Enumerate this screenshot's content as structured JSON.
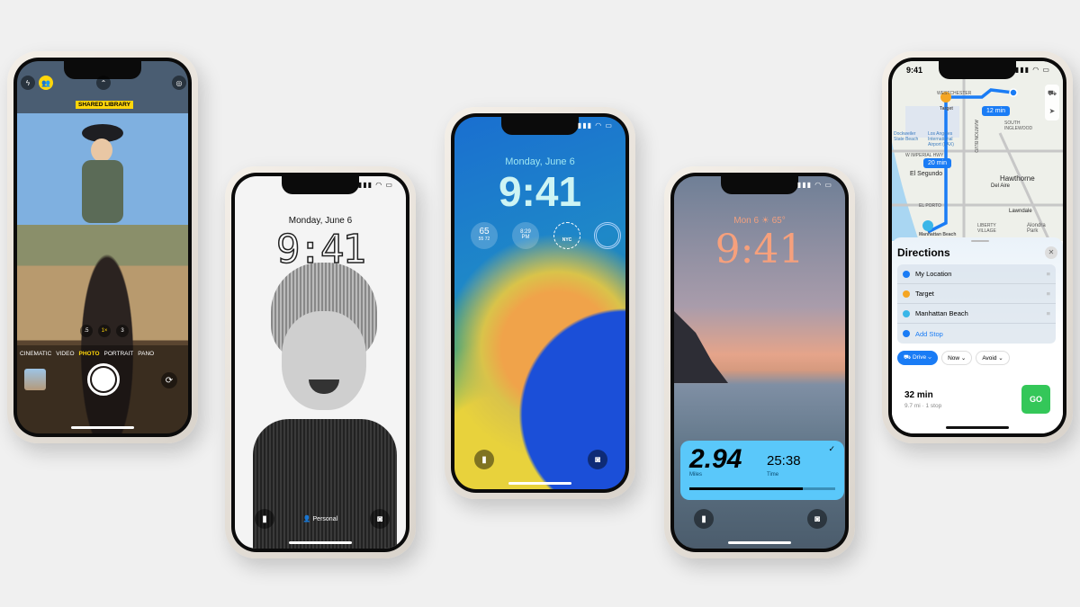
{
  "camera": {
    "shared_library": "SHARED LIBRARY",
    "zoom": [
      ".5",
      "1×",
      "3"
    ],
    "modes": [
      "CINEMATIC",
      "VIDEO",
      "PHOTO",
      "PORTRAIT",
      "PANO"
    ],
    "active_mode": "PHOTO",
    "accent": "#ffd60a"
  },
  "lock_bw": {
    "date": "Monday, June 6",
    "time": "9:41",
    "focus": "Personal"
  },
  "lock_blue": {
    "date": "Monday, June 6",
    "time": "9:41",
    "widgets": {
      "temp": "65",
      "range_lo": "55",
      "range_hi": "72",
      "sunset": "8:29",
      "sunset_ampm": "PM",
      "clock_city": "NYC"
    }
  },
  "lock_sunset": {
    "date": "Mon 6",
    "weather": "☀ 65°",
    "time": "9:41",
    "workout": {
      "miles": "2.94",
      "miles_label": "Miles",
      "time": "25:38",
      "time_label": "Time",
      "progress": 0.78
    },
    "accent": "#5ac8fa"
  },
  "maps": {
    "status_time": "9:41",
    "labels": {
      "westchester": "WESTCHESTER",
      "target": "Target",
      "south_inglewood": "SOUTH INGLEWOOD",
      "dockweiler": "Dockweiler State Beach",
      "lax": "Los Angeles International Airport (LAX)",
      "imperial": "W IMPERIAL HWY",
      "el_segundo": "El Segundo",
      "hawthorne": "Hawthorne",
      "del_aire": "Del Aire",
      "el_porto": "EL PORTO",
      "lawndale": "Lawndale",
      "liberty": "LIBERTY VILLAGE",
      "alondra": "Alondra Park",
      "manhattan": "Manhattan Beach",
      "aviation": "AVIATION BLVD"
    },
    "eta1": "12 min",
    "eta2": "20 min",
    "title": "Directions",
    "stops": [
      "My Location",
      "Target",
      "Manhattan Beach"
    ],
    "add_stop": "Add Stop",
    "chips": {
      "drive": "Drive",
      "now": "Now",
      "avoid": "Avoid"
    },
    "route": {
      "duration": "32 min",
      "detail": "9.7 mi · 1 stop",
      "go": "GO"
    },
    "go_color": "#34c759",
    "route_color": "#1a7cf5"
  }
}
